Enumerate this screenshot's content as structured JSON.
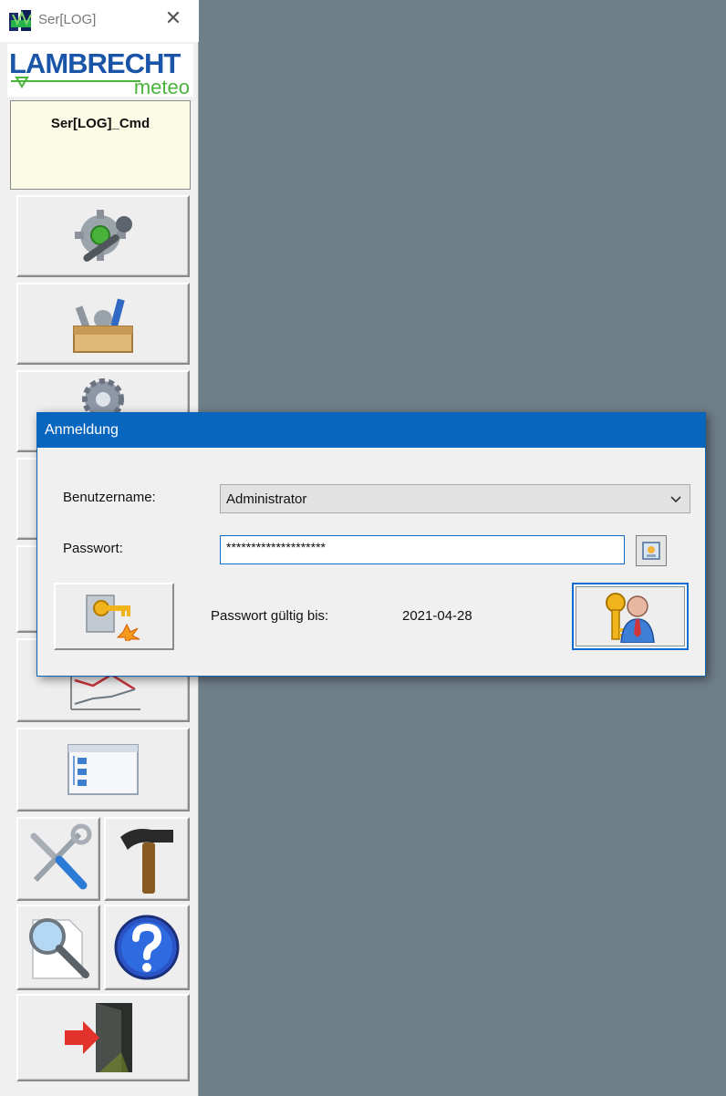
{
  "app": {
    "title": "Ser[LOG]",
    "close_glyph": "✕",
    "logo_brand": "LAMBRECHT",
    "logo_sub": "meteo",
    "cmd_label": "Ser[LOG]_Cmd"
  },
  "toolbar": {
    "buttons": [
      {
        "name": "settings-button",
        "icon": "gear-wrench-icon"
      },
      {
        "name": "toolbox-button",
        "icon": "toolbox-icon"
      },
      {
        "name": "config-button",
        "icon": "gear-icon"
      },
      {
        "name": "chart-button",
        "icon": "line-chart-icon"
      },
      {
        "name": "tree-view-button",
        "icon": "tree-window-icon"
      },
      {
        "name": "tools-button",
        "icon": "screwdriver-wrench-icon"
      },
      {
        "name": "hammer-button",
        "icon": "hammer-icon"
      },
      {
        "name": "search-button",
        "icon": "magnifier-icon"
      },
      {
        "name": "help-button",
        "icon": "help-icon"
      },
      {
        "name": "exit-button",
        "icon": "exit-door-icon"
      }
    ]
  },
  "dialog": {
    "title": "Anmeldung",
    "username_label": "Benutzername:",
    "username_value": "Administrator",
    "password_label": "Passwort:",
    "password_value": "********************",
    "valid_label": "Passwort gültig bis:",
    "valid_date": "2021-04-28"
  },
  "colors": {
    "desktop": "#6f7f89",
    "dialog_title": "#0866be",
    "focus_border": "#0a6cd0",
    "panel_yellow": "#fcfbe6"
  }
}
